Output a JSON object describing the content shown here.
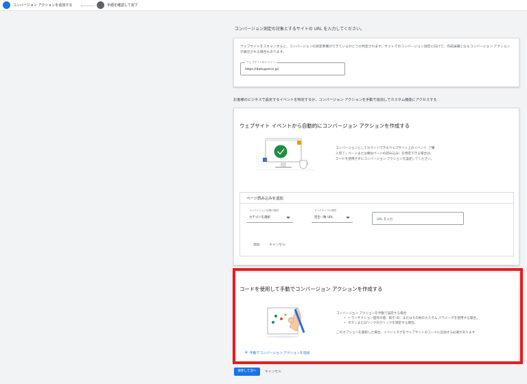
{
  "stepper": {
    "step1": "コンバージョン アクションを追加する",
    "step2": "手順を確認して完了"
  },
  "intro": {
    "title": "コンバージョン測定の対象とするサイトの URL を入力してください。"
  },
  "url_card": {
    "description": "ウェブサイトをスキャンすると、コンバージョンの測定準備ができているかどうか判定されます。サイトでのコンバージョン測定に向けて、作成候補となるコンバージョン アクションが表示される場合もあります。",
    "field_label": "ウェブサイトのドメイン",
    "field_value": "https://datsuperce.jp/"
  },
  "section2": {
    "title": "お客様のビジネスで設定するイベントを特定するか、コンバージョン アクションを手動で追加してカスタム機能にアクセスする"
  },
  "auto_card": {
    "title": "ウェブサイト イベントから自動的にコンバージョン アクションを作成する",
    "description": "コンバージョンとしてカウントできるウェブサイト上のイベント（「購入完了」ページまたは類似ページの読み込み）を特定できる場合は、コードを使用せずにコンバージョン アクションを設定してください。",
    "pageload": {
      "title": "ページ読み込みを追加",
      "category_label": "コンバージョン目標の選択",
      "category_value": "カテゴリを選択",
      "match_label": "マッチタイプの選択",
      "match_value": "完全一致 URL",
      "url_placeholder": "URL を入力",
      "add_label": "追加",
      "cancel_label": "キャンセル"
    }
  },
  "manual_card": {
    "title": "コードを使用して手動でコンバージョン アクションを作成する",
    "description_heading": "コンバージョン アクションを手動で設定する場合",
    "bullets": [
      "トランザクション固有の値、取引 ID、またはその他のカスタム パラメータを使用する場合。",
      "ボタンまたはリンクのクリックを測定する場合。"
    ],
    "note": "このオプションを選択した場合、イベントタグをウェブサイトのコードに追加する必要があります",
    "add_link": "手動でコンバージョン アクションを追加"
  },
  "footer": {
    "save_label": "保存して次へ",
    "cancel_label": "キャンセル"
  },
  "colors": {
    "primary": "#1a73e8",
    "highlight_frame": "#e81c1c",
    "inactive_step": "#5f6368",
    "background": "#f1f3f4"
  },
  "icons": {
    "step1": "step-active-dot-icon",
    "step2": "step-inactive-dot-icon",
    "add": "plus-icon",
    "dropdown": "caret-down-icon"
  }
}
